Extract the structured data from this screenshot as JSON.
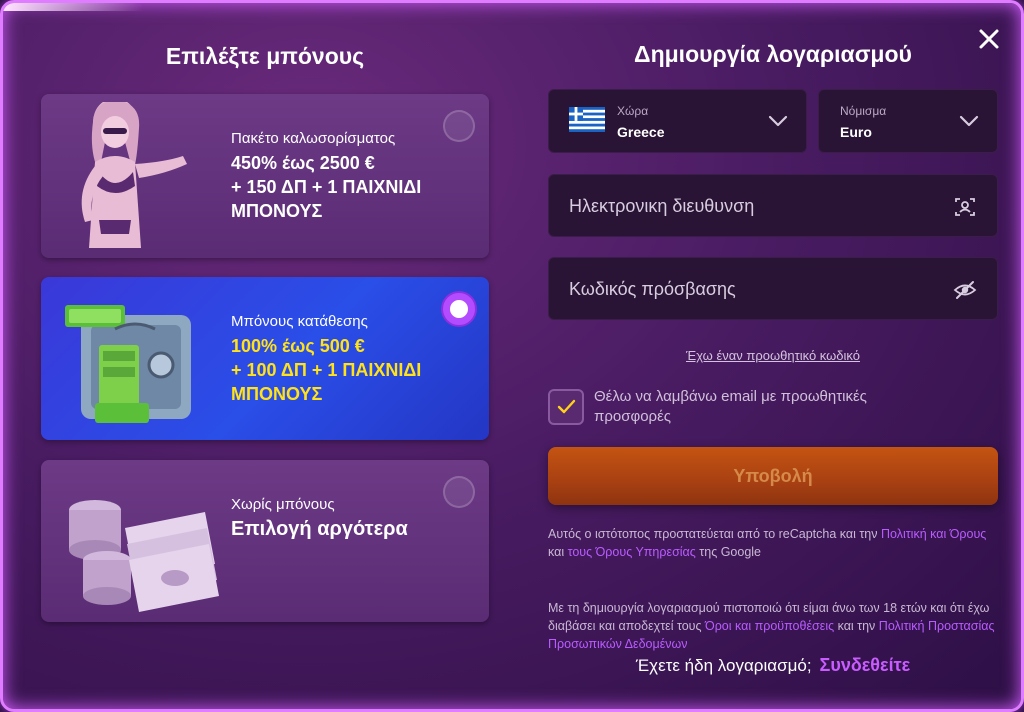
{
  "left": {
    "title": "Επιλέξτε μπόνους",
    "cards": [
      {
        "subtitle": "Πακέτο καλωσορίσματος",
        "line1": "450% έως 2500 €",
        "line2": "+ 150 ΔΠ + 1 ΠΑΙΧΝΙΔΙ",
        "line3": "ΜΠΟΝΟΥΣ",
        "image_icon": "woman-illustration",
        "selected": false
      },
      {
        "subtitle": "Μπόνους κατάθεσης",
        "line1": "100% έως 500 €",
        "line2": "+ 100 ΔΠ + 1 ΠΑΙΧΝΙΔΙ",
        "line3": "ΜΠΟΝΟΥΣ",
        "image_icon": "safe-with-money-illustration",
        "selected": true
      },
      {
        "subtitle": "Χωρίς μπόνους",
        "line1": "Επιλογή αργότερα",
        "image_icon": "chips-and-cash-illustration",
        "selected": false
      }
    ]
  },
  "right": {
    "title": "Δημιουργία λογαριασμού",
    "country": {
      "label": "Χώρα",
      "value": "Greece",
      "flag_icon": "greece-flag-icon"
    },
    "currency": {
      "label": "Νόμισμα",
      "value": "Euro"
    },
    "email": {
      "placeholder": "Ηλεκτρονικη διευθυνση",
      "value": ""
    },
    "password": {
      "placeholder": "Κωδικός πρόσβασης",
      "value": ""
    },
    "promo_link": "Έχω έναν προωθητικό κωδικό",
    "newsletter": {
      "label": "Θέλω να λαμβάνω email με προωθητικές προσφορές",
      "checked": true
    },
    "submit": "Υποβολή",
    "legal1": {
      "text1": "Αυτός ο ιστότοπος προστατεύεται από το reCaptcha και την ",
      "link1": "Πολιτική και Όρους",
      "text2": " και ",
      "link2": "τους Όρους Υπηρεσίας",
      "text3": " της Google"
    },
    "legal2": {
      "text1": "Με τη δημιουργία λογαριασμού πιστοποιώ ότι είμαι άνω των 18 ετών και ότι έχω διαβάσει και αποδεχτεί τους ",
      "link1": "Όροι και προϋποθέσεις",
      "text2": " και την ",
      "link2": "Πολιτική Προστασίας Προσωπικών Δεδομένων"
    },
    "login_prompt": "Έχετε ήδη λογαριασμό;",
    "login_link": "Συνδεθείτε"
  },
  "colors": {
    "accent": "#b95cff",
    "selected_card": "#2a4ee8",
    "submit": "#a84012",
    "highlight_text": "#ffe21a"
  }
}
